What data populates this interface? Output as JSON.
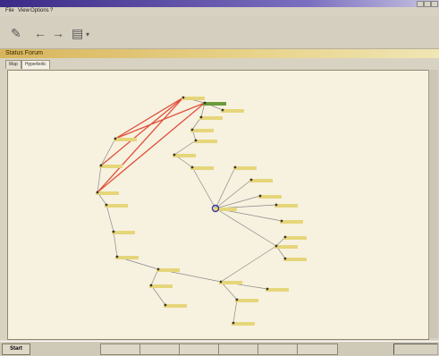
{
  "window": {
    "title": ""
  },
  "menu": [
    {
      "label": "File"
    },
    {
      "label": "View"
    },
    {
      "label": "Options"
    },
    {
      "label": "?"
    }
  ],
  "panel": {
    "title": "Status Forum"
  },
  "tabs": [
    {
      "label": "Map"
    },
    {
      "label": "Hyperbolic"
    }
  ],
  "graph": {
    "nodes": [
      {
        "id": "n1",
        "label": ""
      },
      {
        "id": "n2",
        "label": ""
      },
      {
        "id": "n3",
        "label": ""
      },
      {
        "id": "n4",
        "label": ""
      },
      {
        "id": "n5",
        "label": ""
      },
      {
        "id": "n6",
        "label": ""
      },
      {
        "id": "n7",
        "label": ""
      },
      {
        "id": "n8",
        "label": ""
      },
      {
        "id": "n9",
        "label": ""
      },
      {
        "id": "n10",
        "label": ""
      },
      {
        "id": "n11",
        "label": ""
      },
      {
        "id": "n12",
        "label": ""
      },
      {
        "id": "n13",
        "label": ""
      },
      {
        "id": "n14",
        "label": ""
      },
      {
        "id": "n15",
        "label": ""
      },
      {
        "id": "n16",
        "label": ""
      },
      {
        "id": "n17",
        "label": ""
      },
      {
        "id": "n18",
        "label": ""
      },
      {
        "id": "n19",
        "label": ""
      },
      {
        "id": "n20",
        "label": ""
      },
      {
        "id": "n21",
        "label": ""
      },
      {
        "id": "n22",
        "label": ""
      },
      {
        "id": "n23",
        "label": ""
      },
      {
        "id": "n24",
        "label": ""
      },
      {
        "id": "n25",
        "label": ""
      },
      {
        "id": "n26",
        "label": ""
      },
      {
        "id": "n27",
        "label": ""
      },
      {
        "id": "n28",
        "label": ""
      },
      {
        "id": "n29",
        "label": ""
      },
      {
        "id": "n30",
        "label": ""
      }
    ]
  },
  "taskbar": {
    "start_label": "Start",
    "tasks": [
      {
        "label": ""
      },
      {
        "label": ""
      },
      {
        "label": ""
      },
      {
        "label": ""
      },
      {
        "label": ""
      },
      {
        "label": ""
      }
    ],
    "tray_label": ""
  },
  "colors": {
    "red_edge": "#e0503a",
    "gray_edge": "#8a8a8a",
    "node_label_bg": "#e6d67a",
    "selected_node_bg": "#6a9a3a",
    "focus_node": "#3a3aa0"
  }
}
